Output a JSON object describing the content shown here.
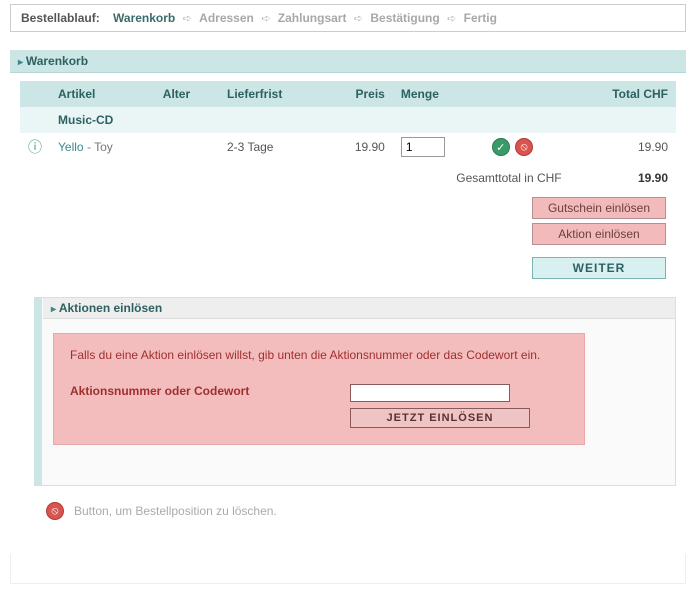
{
  "breadcrumb": {
    "label": "Bestellablauf:",
    "steps": [
      "Warenkorb",
      "Adressen",
      "Zahlungsart",
      "Bestätigung",
      "Fertig"
    ],
    "active_index": 0
  },
  "cart": {
    "header": "Warenkorb",
    "columns": {
      "article": "Artikel",
      "age": "Alter",
      "delivery": "Lieferfrist",
      "price": "Preis",
      "qty": "Menge",
      "total": "Total CHF"
    },
    "category": "Music-CD",
    "items": [
      {
        "artist": "Yello",
        "title": "Toy",
        "age": "",
        "delivery": "2-3 Tage",
        "price": "19.90",
        "qty": "1",
        "line_total": "19.90"
      }
    ],
    "totals": {
      "label": "Gesamttotal in CHF",
      "amount": "19.90"
    },
    "buttons": {
      "voucher": "Gutschein einlösen",
      "promo": "Aktion einlösen",
      "continue": "WEITER"
    }
  },
  "redeem": {
    "header": "Aktionen einlösen",
    "intro": "Falls du eine Aktion einlösen willst, gib unten die Aktionsnummer oder das Codewort ein.",
    "label": "Aktionsnummer oder Codewort",
    "submit": "JETZT EINLÖSEN"
  },
  "obscured": {
    "text": "Button, um Bestellposition zu löschen."
  },
  "icons": {
    "info": "ⓘ",
    "ok": "✓",
    "del": "⦸"
  }
}
